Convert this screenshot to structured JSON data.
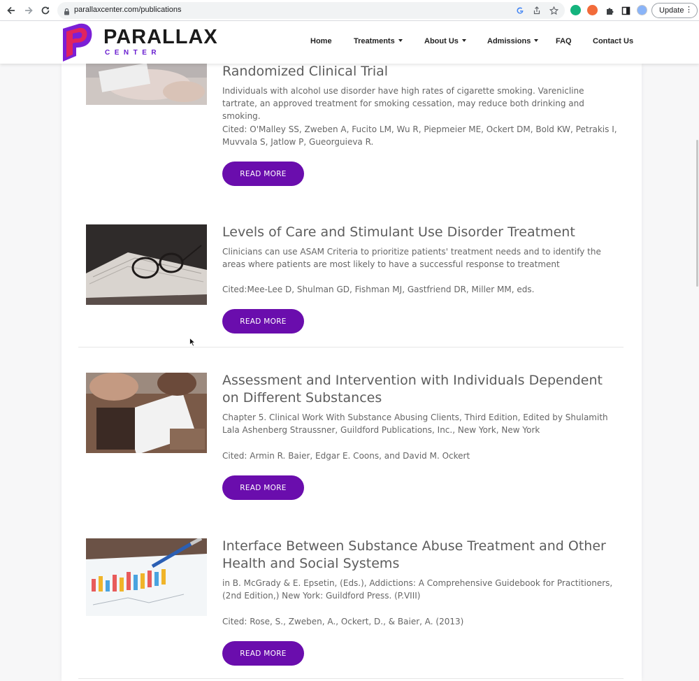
{
  "browser": {
    "url": "parallaxcenter.com/publications",
    "update_label": "Update",
    "menu_dots": "⋮"
  },
  "site": {
    "logo_main": "PARALLAX",
    "logo_sub": "CENTER",
    "brand_color": "#6a0dad",
    "nav": [
      {
        "label": "Home",
        "dropdown": false
      },
      {
        "label": "Treatments",
        "dropdown": true
      },
      {
        "label": "About Us",
        "dropdown": true
      },
      {
        "label": "Admissions",
        "dropdown": true
      },
      {
        "label": "FAQ",
        "dropdown": false
      },
      {
        "label": "Contact Us",
        "dropdown": false
      }
    ]
  },
  "publications": [
    {
      "title": "Randomized Clinical Trial",
      "description": "Individuals with alcohol use disorder have high rates of cigarette smoking. Varenicline tartrate, an approved treatment for smoking cessation, may reduce both drinking and smoking.",
      "cited": "Cited: O'Malley SS, Zweben A, Fucito LM, Wu R, Piepmeier ME, Ockert DM, Bold KW, Petrakis I, Muvvala S, Jatlow P, Gueorguieva R.",
      "button": "READ MORE"
    },
    {
      "title": "Levels of Care and Stimulant Use Disorder Treatment",
      "description": "Clinicians can use ASAM Criteria to prioritize patients' treatment needs and to identify the areas where patients are most likely to have a successful response to treatment",
      "cited": "Cited:Mee-Lee D, Shulman GD, Fishman MJ, Gastfriend DR, Miller MM, eds.",
      "button": "READ MORE"
    },
    {
      "title": "Assessment and Intervention with Individuals Dependent on Different Substances",
      "description": "Chapter 5. Clinical Work With Substance Abusing Clients, Third Edition, Edited by Shulamith Lala Ashenberg Straussner, Guildford Publications, Inc., New York, New York",
      "cited": "Cited: Armin R. Baier, Edgar E. Coons, and David M. Ockert",
      "button": "READ MORE"
    },
    {
      "title": "Interface Between Substance Abuse Treatment and Other Health and Social Systems",
      "description": "in B. McGrady & E. Epsetin, (Eds.), Addictions: A Comprehensive Guidebook for Practitioners, (2nd Edition,) New York: Guildford Press. (P.VIII)",
      "cited": "Cited: Rose, S., Zweben, A., Ockert, D., & Baier, A. (2013)",
      "button": "READ MORE"
    }
  ]
}
